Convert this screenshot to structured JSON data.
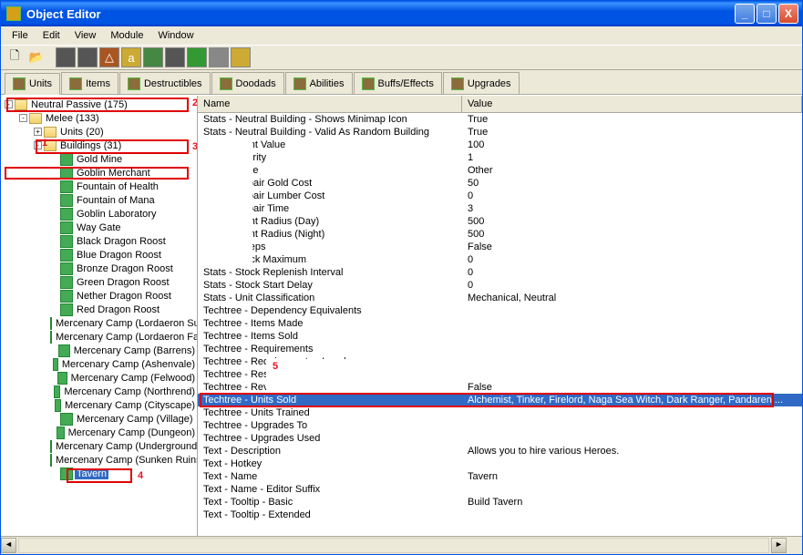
{
  "title": "Object Editor",
  "menu": {
    "file": "File",
    "edit": "Edit",
    "view": "View",
    "module": "Module",
    "window": "Window"
  },
  "tabs": {
    "units": "Units",
    "items": "Items",
    "destructibles": "Destructibles",
    "doodads": "Doodads",
    "abilities": "Abilities",
    "buffs": "Buffs/Effects",
    "upgrades": "Upgrades"
  },
  "tree": {
    "root": "Neutral Passive (175)",
    "melee": "Melee (133)",
    "units": "Units (20)",
    "buildings": "Buildings (31)",
    "items": [
      "Gold Mine",
      "Goblin Merchant",
      "Fountain of Health",
      "Fountain of Mana",
      "Goblin Laboratory",
      "Way Gate",
      "Black Dragon Roost",
      "Blue Dragon Roost",
      "Bronze Dragon Roost",
      "Green Dragon Roost",
      "Nether Dragon Roost",
      "Red Dragon Roost",
      "Mercenary Camp (Lordaeron Summer)",
      "Mercenary Camp (Lordaeron Fall)",
      "Mercenary Camp (Barrens)",
      "Mercenary Camp (Ashenvale)",
      "Mercenary Camp (Felwood)",
      "Mercenary Camp (Northrend)",
      "Mercenary Camp (Cityscape)",
      "Mercenary Camp (Village)",
      "Mercenary Camp (Dungeon)",
      "Mercenary Camp (Underground)",
      "Mercenary Camp (Sunken Ruins)",
      "Tavern"
    ]
  },
  "propheader": {
    "name": "Name",
    "value": "Value"
  },
  "props": [
    {
      "n": "Stats - Neutral Building - Shows Minimap Icon",
      "v": "True"
    },
    {
      "n": "Stats - Neutral Building - Valid As Random Building",
      "v": "True"
    },
    {
      "n": "Stats - Point Value",
      "v": "100"
    },
    {
      "n": "Stats - Priority",
      "v": "1"
    },
    {
      "n": "Stats - Race",
      "v": "Other"
    },
    {
      "n": "Stats - Repair Gold Cost",
      "v": "50"
    },
    {
      "n": "Stats - Repair Lumber Cost",
      "v": "0"
    },
    {
      "n": "Stats - Repair Time",
      "v": "3"
    },
    {
      "n": "Stats - Sight Radius (Day)",
      "v": "500"
    },
    {
      "n": "Stats - Sight Radius (Night)",
      "v": "500"
    },
    {
      "n": "Stats - Sleeps",
      "v": "False"
    },
    {
      "n": "Stats - Stock Maximum",
      "v": "0"
    },
    {
      "n": "Stats - Stock Replenish Interval",
      "v": "0"
    },
    {
      "n": "Stats - Stock Start Delay",
      "v": "0"
    },
    {
      "n": "Stats - Unit Classification",
      "v": "Mechanical, Neutral"
    },
    {
      "n": "Techtree - Dependency Equivalents",
      "v": ""
    },
    {
      "n": "Techtree - Items Made",
      "v": ""
    },
    {
      "n": "Techtree - Items Sold",
      "v": ""
    },
    {
      "n": "Techtree - Requirements",
      "v": ""
    },
    {
      "n": "Techtree - Requirements - Levels",
      "v": ""
    },
    {
      "n": "Techtree - Researches Available",
      "v": ""
    },
    {
      "n": "Techtree - Revives Dead Heroes",
      "v": "False"
    },
    {
      "n": "Techtree - Units Sold",
      "v": "Alchemist, Tinker, Firelord, Naga Sea Witch, Dark Ranger, Pandaren ..."
    },
    {
      "n": "Techtree - Units Trained",
      "v": ""
    },
    {
      "n": "Techtree - Upgrades To",
      "v": ""
    },
    {
      "n": "Techtree - Upgrades Used",
      "v": ""
    },
    {
      "n": "Text - Description",
      "v": "Allows you to hire various Heroes."
    },
    {
      "n": "Text - Hotkey",
      "v": ""
    },
    {
      "n": "Text - Name",
      "v": "Tavern"
    },
    {
      "n": "Text - Name - Editor Suffix",
      "v": ""
    },
    {
      "n": "Text - Tooltip - Basic",
      "v": "Build Tavern"
    },
    {
      "n": "Text - Tooltip - Extended",
      "v": ""
    }
  ],
  "annotations": {
    "n1": "1",
    "n2": "2",
    "n3": "3",
    "n4": "4",
    "n5": "5"
  }
}
